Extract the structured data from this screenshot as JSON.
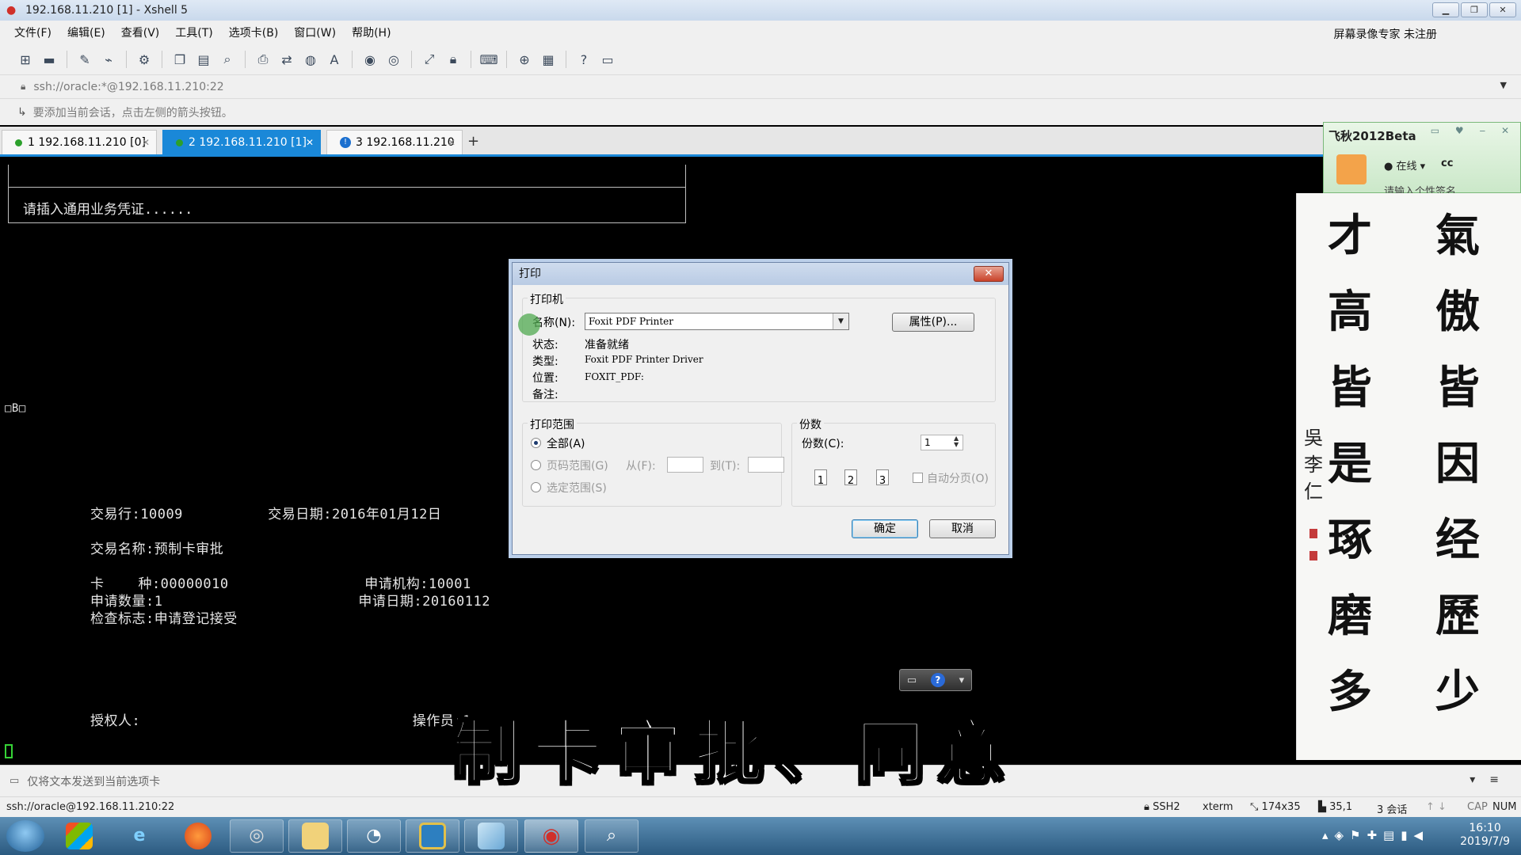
{
  "window": {
    "title": "192.168.11.210 [1] - Xshell 5",
    "min": "▁",
    "restore": "❐",
    "close": "✕"
  },
  "menu": {
    "items": [
      "文件(F)",
      "编辑(E)",
      "查看(V)",
      "工具(T)",
      "选项卡(B)",
      "窗口(W)",
      "帮助(H)"
    ],
    "watermark": "屏幕录像专家 未注册"
  },
  "toolbar": {
    "icons": [
      "new-session-icon",
      "open-folder-icon",
      "reconnect-icon",
      "disconnect-icon",
      "properties-icon",
      "copy-icon",
      "paste-icon",
      "find-icon",
      "print-icon",
      "transfer-icon",
      "globe-icon",
      "font-icon",
      "xftp-icon",
      "xmanager-icon",
      "fullscreen-icon",
      "lock-icon",
      "keyboard-icon",
      "add-tab-icon",
      "layout-icon",
      "help-icon",
      "chat-icon"
    ]
  },
  "address": {
    "value": "ssh://oracle:*@192.168.11.210:22"
  },
  "hint": {
    "text": "要添加当前会话，点击左侧的箭头按钮。"
  },
  "tabs": [
    {
      "label": "1 192.168.11.210 [0]",
      "status": "connected"
    },
    {
      "label": "2 192.168.11.210 [1]",
      "status": "connected"
    },
    {
      "label": "3 192.168.11.210",
      "status": "info"
    }
  ],
  "terminal": {
    "prompt_text": "请插入通用业务凭证......",
    "stray": "□B□",
    "line1": "交易行:10009          交易日期:2016年01月12日",
    "line2": "交易名称:预制卡审批",
    "line3": "卡    种:00000010                申请机构:10001",
    "line4": "申请数量:1                       申请日期:20160112",
    "line5": "检查标志:申请登记接受",
    "line6": "授权人:                                操作员:10",
    "subtitle": "制卡审批、同意"
  },
  "print_dialog": {
    "title": "打印",
    "printer_group": "打印机",
    "name_label": "名称(N):",
    "name_value": "Foxit PDF Printer",
    "properties_button": "属性(P)...",
    "status_label": "状态:",
    "status_value": "准备就绪",
    "type_label": "类型:",
    "type_value": "Foxit PDF Printer Driver",
    "location_label": "位置:",
    "location_value": "FOXIT_PDF:",
    "comment_label": "备注:",
    "range_group": "打印范围",
    "range_all": "全部(A)",
    "range_pages": "页码范围(G)",
    "range_from": "从(F):",
    "range_to": "到(T):",
    "range_selection": "选定范围(S)",
    "copies_group": "份数",
    "copies_label": "份数(C):",
    "copies_value": "1",
    "collate_label": "自动分页(O)",
    "ok_button": "确定",
    "cancel_button": "取消"
  },
  "qq": {
    "title": "飞秋2012Beta",
    "status": "在线",
    "user": "cc",
    "signature": "请输入个性签名"
  },
  "calligraphy": {
    "col_right": [
      "氣",
      "傲",
      "皆",
      "因",
      "经",
      "歷",
      "少"
    ],
    "col_left": [
      "才",
      "高",
      "皆",
      "是",
      "琢",
      "磨",
      "多"
    ],
    "signature": [
      "吳",
      "李",
      "仁"
    ]
  },
  "compose": {
    "text": "仅将文本发送到当前选项卡"
  },
  "status": {
    "address": "ssh://oracle@192.168.11.210:22",
    "protocol": "SSH2",
    "terminal": "xterm",
    "size": "174x35",
    "cursor": "35,1",
    "sessions": "3 会话",
    "cap": "CAP",
    "num": "NUM"
  },
  "taskbar": {
    "apps": [
      "start-button",
      "windows-flag-icon",
      "ie-icon",
      "firefox-icon",
      "record-icon",
      "explorer-icon",
      "app-icon",
      "monitor-icon",
      "notes-icon",
      "xshell-icon",
      "search-icon"
    ],
    "time": "16:10",
    "date": "2019/7/9"
  },
  "colors": {
    "tab_active": "#1a88d8",
    "terminal_bg": "#000000",
    "terminal_fg": "#e6e6e6"
  }
}
